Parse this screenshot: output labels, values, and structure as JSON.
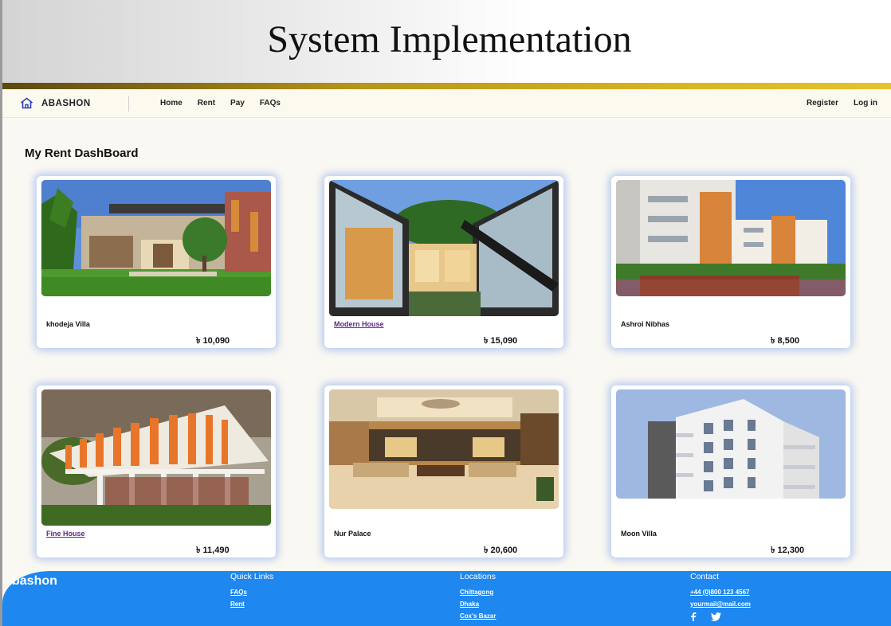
{
  "slide": {
    "title": "System Implementation"
  },
  "navbar": {
    "brand": "ABASHON",
    "links": [
      "Home",
      "Rent",
      "Pay",
      "FAQs"
    ],
    "register": "Register",
    "login": "Log in"
  },
  "dashboard": {
    "title": "My Rent DashBoard",
    "properties": [
      {
        "name": "khodeja Villa",
        "price": "৳ 10,090",
        "linked": false
      },
      {
        "name": "Modern House",
        "price": "৳ 15,090",
        "linked": true
      },
      {
        "name": "Ashroi Nibhas",
        "price": "৳ 8,500",
        "linked": false
      },
      {
        "name": "Fine House",
        "price": "৳ 11,490",
        "linked": true
      },
      {
        "name": "Nur Palace",
        "price": "৳ 20,600",
        "linked": false
      },
      {
        "name": "Moon Villa",
        "price": "৳ 12,300",
        "linked": false
      }
    ]
  },
  "footer": {
    "brand": "bashon",
    "quick_links": {
      "title": "Quick Links",
      "items": [
        "FAQs",
        "Rent"
      ]
    },
    "locations": {
      "title": "Locations",
      "items": [
        "Chittagong",
        "Dhaka",
        "Cox's Bazar"
      ]
    },
    "contact": {
      "title": "Contact",
      "phone": "+44 (0)800 123 4567",
      "email": "yourmail@mail.com"
    }
  },
  "colors": {
    "accent": "#1e87f0",
    "gold": "#d8b420",
    "link_purple": "#5a2a82"
  },
  "icons": [
    "home-icon",
    "facebook-icon",
    "twitter-icon"
  ]
}
